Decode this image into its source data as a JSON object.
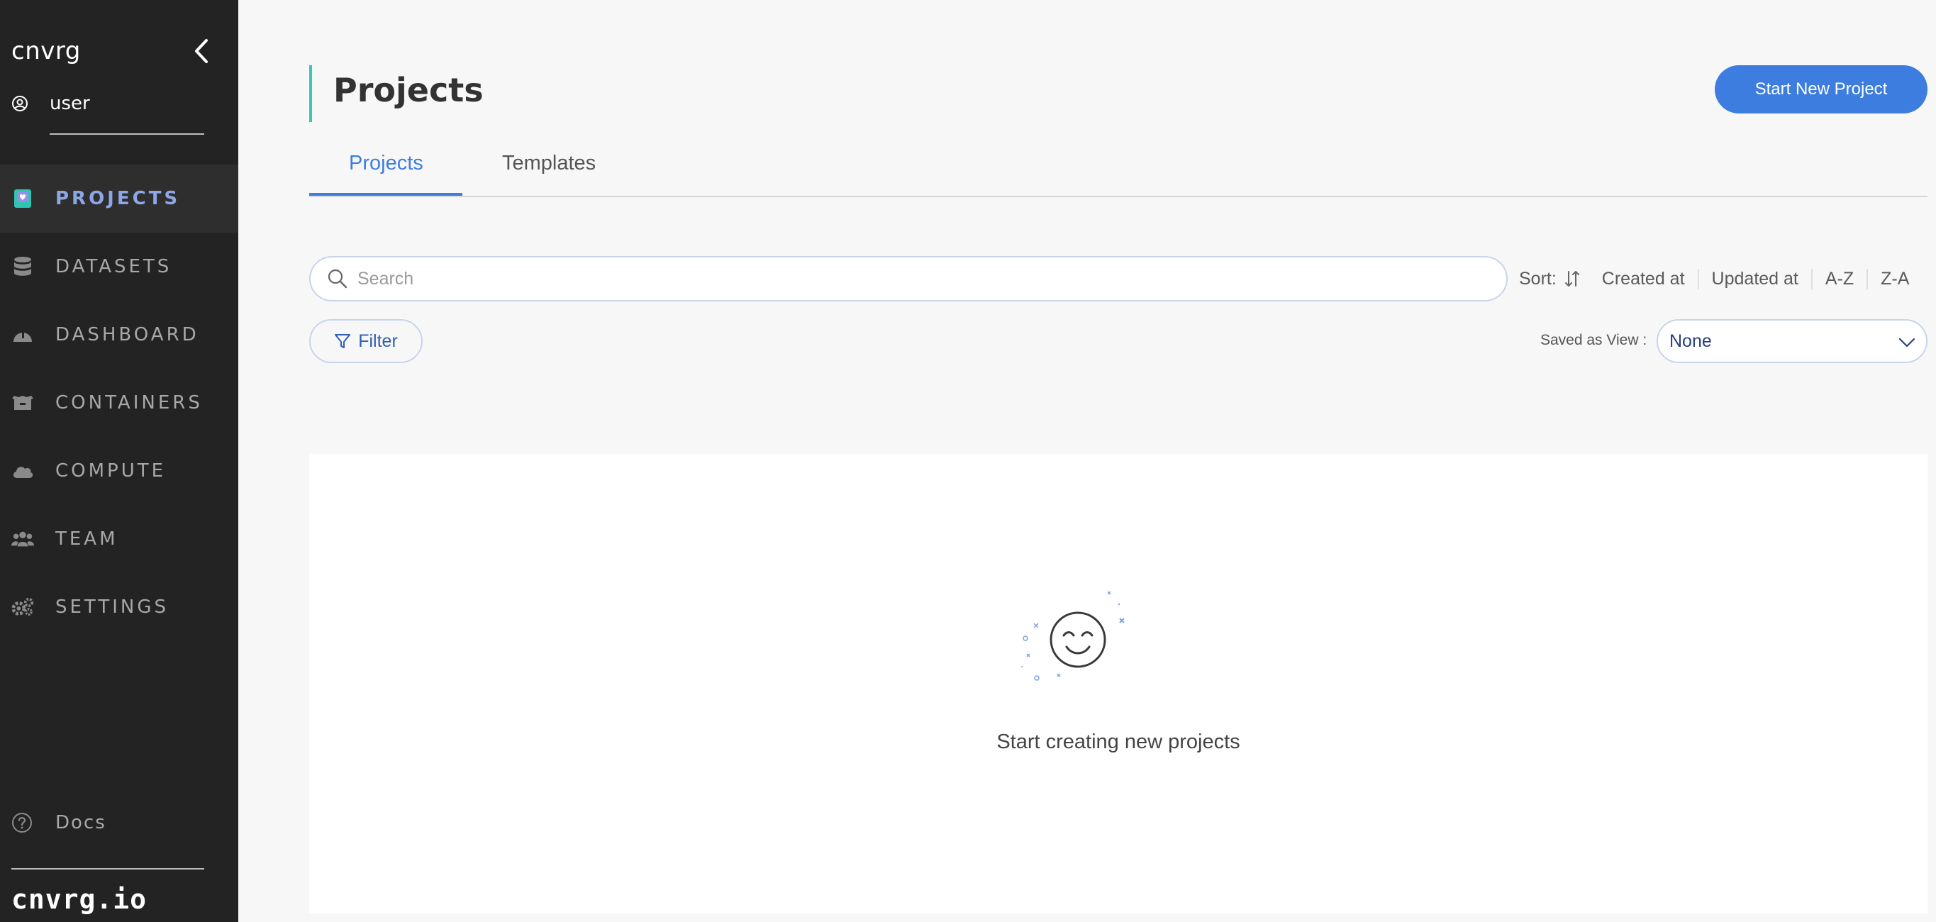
{
  "sidebar": {
    "brand": "cnvrg",
    "user": "user",
    "items": [
      {
        "label": "PROJECTS",
        "icon": "projects-icon",
        "active": true
      },
      {
        "label": "DATASETS",
        "icon": "datasets-icon",
        "active": false
      },
      {
        "label": "DASHBOARD",
        "icon": "dashboard-icon",
        "active": false
      },
      {
        "label": "CONTAINERS",
        "icon": "containers-icon",
        "active": false
      },
      {
        "label": "COMPUTE",
        "icon": "compute-icon",
        "active": false
      },
      {
        "label": "TEAM",
        "icon": "team-icon",
        "active": false
      },
      {
        "label": "SETTINGS",
        "icon": "settings-icon",
        "active": false
      }
    ],
    "docs": "Docs",
    "footer_logo": "cnvrg.io"
  },
  "main": {
    "title": "Projects",
    "start_button": "Start New Project",
    "tabs": [
      {
        "label": "Projects",
        "active": true
      },
      {
        "label": "Templates",
        "active": false
      }
    ],
    "search": {
      "placeholder": "Search",
      "value": ""
    },
    "sort": {
      "label": "Sort:",
      "options": [
        "Created at",
        "Updated at",
        "A-Z",
        "Z-A"
      ]
    },
    "filter_label": "Filter",
    "saved_view": {
      "label": "Saved as View :",
      "value": "None"
    },
    "empty_message": "Start creating new projects"
  },
  "colors": {
    "sidebar_bg": "#232323",
    "accent": "#3d7de0",
    "active_nav": "#8ca6e6",
    "title_bar": "#3cc6b8"
  }
}
